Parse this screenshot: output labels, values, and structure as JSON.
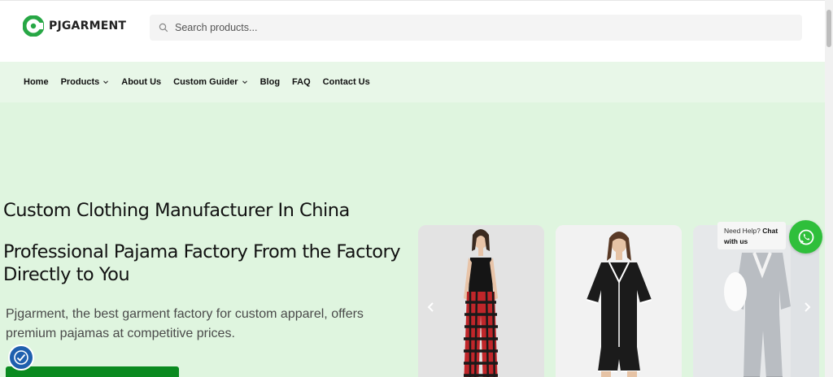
{
  "brand": {
    "name": "PJGARMENT",
    "color": "#27a745"
  },
  "search": {
    "placeholder": "Search products..."
  },
  "nav": {
    "items": [
      {
        "label": "Home",
        "has_dropdown": false
      },
      {
        "label": "Products",
        "has_dropdown": true
      },
      {
        "label": "About Us",
        "has_dropdown": false
      },
      {
        "label": "Custom Guider",
        "has_dropdown": true
      },
      {
        "label": "Blog",
        "has_dropdown": false
      },
      {
        "label": "FAQ",
        "has_dropdown": false
      },
      {
        "label": "Contact Us",
        "has_dropdown": false
      }
    ]
  },
  "hero": {
    "heading": "Custom Clothing Manufacturer In China",
    "subheading": "Professional Pajama Factory From the Factory Directly to You",
    "description": "Pjgarment, the best garment factory for custom apparel, offers premium pajamas at competitive prices.",
    "background": "#dff5df"
  },
  "carousel": {
    "items": [
      {
        "name": "black-tank-red-plaid-pajama-pants"
      },
      {
        "name": "black-short-sleeve-pajama-set-white-piping"
      },
      {
        "name": "grey-fleece-pajama-set"
      }
    ]
  },
  "chat": {
    "line1": "Need Help?",
    "line2_bold": "Chat",
    "line3_bold": "with us",
    "color": "#2fbf3b"
  },
  "colors": {
    "nav_bg": "#e8f7e8",
    "cta": "#0a8a1f",
    "a11y": "#1f5fae"
  }
}
